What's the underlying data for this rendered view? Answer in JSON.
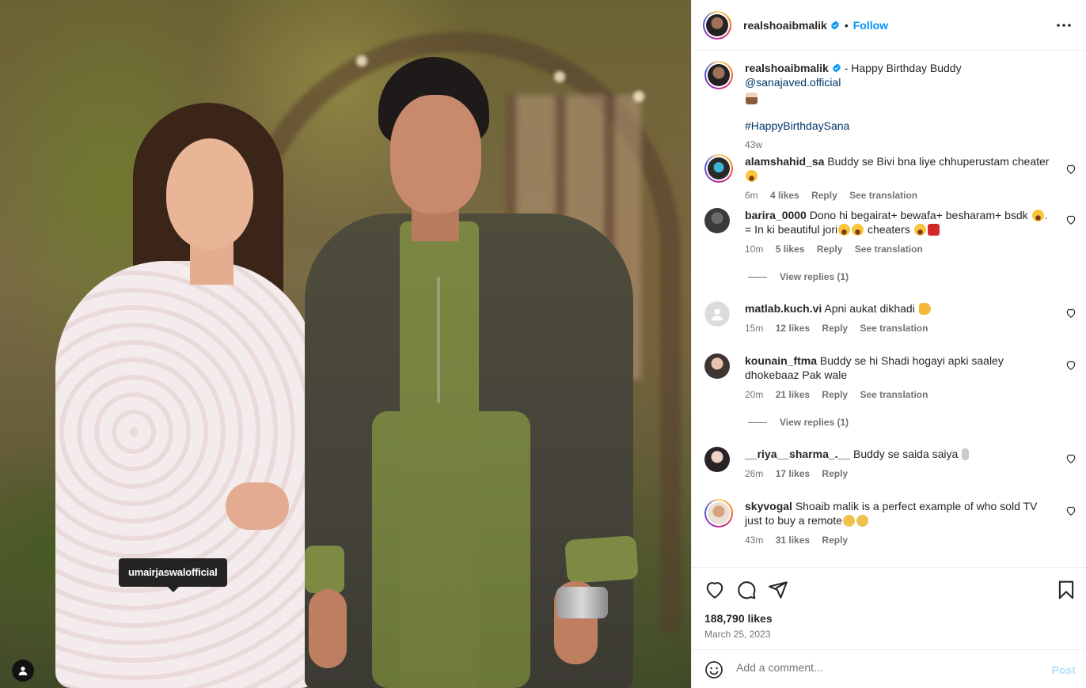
{
  "media": {
    "tag_label": "umairjaswalofficial"
  },
  "post": {
    "author": "realshoaibmalik",
    "follow_label": "Follow",
    "separator": "•",
    "caption": {
      "prefix": " - Happy Birthday Buddy ",
      "mention": "@sanajaved.official",
      "hashtag": "#HappyBirthdaySana",
      "age": "43w"
    },
    "likes": "188,790 likes",
    "date": "March 25, 2023"
  },
  "comments": [
    {
      "user": "alamshahid_sa",
      "text": "Buddy se Bivi bna liye chhuperustam cheater",
      "time": "6m",
      "likes": "4 likes",
      "reply": "Reply",
      "translate": "See translation"
    },
    {
      "user": "barira_0000",
      "text": "Dono hi begairat+ bewafa+ besharam+ bsdk",
      "text2": "= In ki beautiful jori",
      "text3": " cheaters ",
      "time": "10m",
      "likes": "5 likes",
      "reply": "Reply",
      "translate": "See translation",
      "view_replies": "View replies (1)"
    },
    {
      "user": "matlab.kuch.vi",
      "text": "Apni aukat dikhadi",
      "time": "15m",
      "likes": "12 likes",
      "reply": "Reply",
      "translate": "See translation"
    },
    {
      "user": "kounain_ftma",
      "text": "Buddy se hi Shadi hogayi apki saaley dhokebaaz Pak wale",
      "time": "20m",
      "likes": "21 likes",
      "reply": "Reply",
      "translate": "See translation",
      "view_replies": "View replies (1)"
    },
    {
      "user": "__riya__sharma_.__",
      "text": "Buddy se saida saiya",
      "time": "26m",
      "likes": "17 likes",
      "reply": "Reply"
    },
    {
      "user": "skyvogal",
      "text": "Shoaib malik is a perfect example of who sold TV just to buy a remote",
      "time": "43m",
      "likes": "31 likes",
      "reply": "Reply"
    }
  ],
  "composer": {
    "placeholder": "Add a comment...",
    "post_label": "Post"
  },
  "icons": {
    "verified": "verified-badge-icon",
    "more": "more-options-icon",
    "like": "heart-icon",
    "comment": "comment-icon",
    "share": "share-icon",
    "save": "bookmark-icon",
    "emoji": "emoji-icon",
    "tag": "user-tag-icon"
  },
  "colors": {
    "accent": "#0095f6",
    "link": "#00376b",
    "muted": "#737373"
  }
}
